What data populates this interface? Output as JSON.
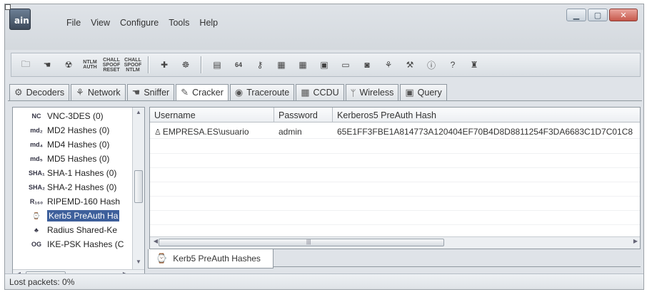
{
  "app": {
    "icon_text": "ain"
  },
  "menu": [
    "File",
    "View",
    "Configure",
    "Tools",
    "Help"
  ],
  "toolbar_icons": [
    "open-icon",
    "hand-icon",
    "radiation-icon",
    "ntlm-auth-icon",
    "chall-spoof-reset-icon",
    "chall-spoof-ntlm-icon",
    "plus-icon",
    "sniff-icon",
    "document-icon",
    "base64-icon",
    "key-icon",
    "grid1-icon",
    "grid2-icon",
    "nc-icon",
    "monitor1-icon",
    "monitor2-icon",
    "network-icon",
    "wrench-icon",
    "info-icon",
    "help-icon",
    "person-icon"
  ],
  "toolbar_small_labels": {
    "ntlm_auth": "NTLM AUTH",
    "chall_spoof_reset": "CHALL SPOOF RESET",
    "chall_spoof_ntlm": "CHALL SPOOF NTLM",
    "base64": "64"
  },
  "tabs": [
    {
      "label": "Decoders",
      "icon": "decoder-icon"
    },
    {
      "label": "Network",
      "icon": "network-icon"
    },
    {
      "label": "Sniffer",
      "icon": "sniffer-icon"
    },
    {
      "label": "Cracker",
      "icon": "cracker-icon",
      "active": true
    },
    {
      "label": "Traceroute",
      "icon": "traceroute-icon"
    },
    {
      "label": "CCDU",
      "icon": "ccdu-icon"
    },
    {
      "label": "Wireless",
      "icon": "wireless-icon"
    },
    {
      "label": "Query",
      "icon": "query-icon"
    }
  ],
  "tree": [
    {
      "label": "VNC-3DES (0)",
      "icon": "nc"
    },
    {
      "label": "MD2 Hashes (0)",
      "icon": "md2"
    },
    {
      "label": "MD4 Hashes (0)",
      "icon": "md4"
    },
    {
      "label": "MD5 Hashes (0)",
      "icon": "md5"
    },
    {
      "label": "SHA-1 Hashes (0)",
      "icon": "sha1"
    },
    {
      "label": "SHA-2 Hashes (0)",
      "icon": "sha2"
    },
    {
      "label": "RIPEMD-160 Hash",
      "icon": "ripemd"
    },
    {
      "label": "Kerb5 PreAuth Ha",
      "icon": "kerberos",
      "selected": true
    },
    {
      "label": "Radius Shared-Ke",
      "icon": "radius"
    },
    {
      "label": "IKE-PSK Hashes (C",
      "icon": "ike"
    }
  ],
  "tree_icon_text": {
    "nc": "NC",
    "md2": "md₂",
    "md4": "md₄",
    "md5": "md₅",
    "sha1": "SHA₁",
    "sha2": "SHA₂",
    "ripemd": "R₁₆₀",
    "kerberos": "⌚",
    "radius": "♣",
    "ike": "OG"
  },
  "grid": {
    "columns": [
      "Username",
      "Password",
      "Kerberos5 PreAuth Hash"
    ],
    "rows": [
      {
        "username": "EMPRESA.ES\\usuario",
        "password": "admin",
        "hash": "65E1FF3FBE1A814773A120404EF70B4D8D8811254F3DA6683C1D7C01C8"
      }
    ]
  },
  "subtab": {
    "label": "Kerb5 PreAuth Hashes"
  },
  "status": {
    "text": "Lost packets:  0%"
  }
}
